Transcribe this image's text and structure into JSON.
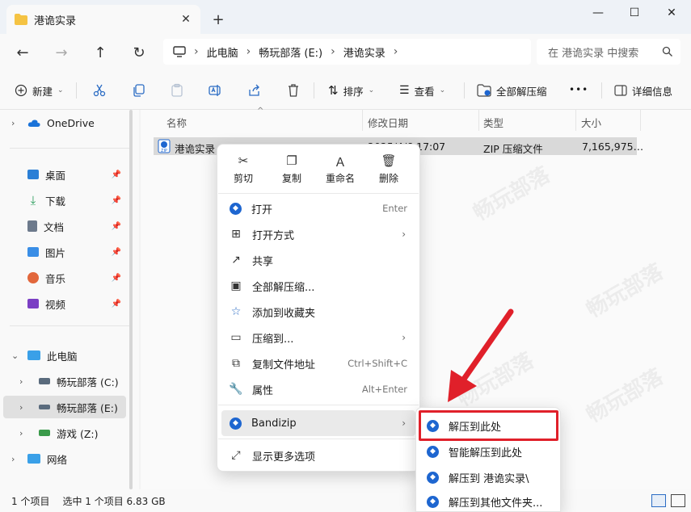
{
  "window": {
    "tab_title": "港诡实录",
    "tab_close_glyph": "✕",
    "new_tab_glyph": "+",
    "min_glyph": "—",
    "max_glyph": "☐",
    "close_glyph": "✕"
  },
  "nav": {
    "back": "←",
    "forward": "→",
    "up": "↑",
    "refresh": "↻"
  },
  "address": {
    "crumbs": [
      "此电脑",
      "畅玩部落 (E:)",
      "港诡实录"
    ],
    "sep": "›",
    "search_placeholder": "在 港诡实录 中搜索"
  },
  "toolbar": {
    "new_label": "新建",
    "sort_label": "排序",
    "view_label": "查看",
    "extract_all_label": "全部解压缩",
    "more_label": "•••",
    "details_label": "详细信息"
  },
  "sidebar": {
    "onedrive": "OneDrive",
    "quick": [
      {
        "label": "桌面",
        "color": "#2b7fd6"
      },
      {
        "label": "下载",
        "color": "#2a9d5c"
      },
      {
        "label": "文档",
        "color": "#6d7a8c"
      },
      {
        "label": "图片",
        "color": "#3a8ee6"
      },
      {
        "label": "音乐",
        "color": "#e2673c"
      },
      {
        "label": "视频",
        "color": "#7b3fc4"
      }
    ],
    "this_pc": "此电脑",
    "drives": [
      "畅玩部落 (C:)",
      "畅玩部落 (E:)",
      "游戏 (Z:)"
    ],
    "network": "网络"
  },
  "columns": {
    "name": "名称",
    "modified": "修改日期",
    "type": "类型",
    "size": "大小"
  },
  "file": {
    "name": "港诡实录",
    "modified": "2025/4/6 17:07",
    "type": "ZIP 压缩文件",
    "size": "7,165,975…"
  },
  "status": {
    "count": "1 个项目",
    "selected": "选中 1 个项目  6.83 GB"
  },
  "context_menu": {
    "quick_actions": [
      "剪切",
      "复制",
      "重命名",
      "删除"
    ],
    "items": [
      {
        "label": "打开",
        "accel": "Enter"
      },
      {
        "label": "打开方式",
        "accel": ""
      },
      {
        "label": "共享",
        "accel": ""
      },
      {
        "label": "全部解压缩...",
        "accel": ""
      },
      {
        "label": "添加到收藏夹",
        "accel": ""
      },
      {
        "label": "压缩到...",
        "accel": ""
      },
      {
        "label": "复制文件地址",
        "accel": "Ctrl+Shift+C"
      },
      {
        "label": "属性",
        "accel": "Alt+Enter"
      },
      {
        "label": "Bandizip",
        "accel": ""
      },
      {
        "label": "显示更多选项",
        "accel": ""
      }
    ]
  },
  "submenu": {
    "items": [
      "解压到此处",
      "智能解压到此处",
      "解压到 港诡实录\\",
      "解压到其他文件夹..."
    ]
  },
  "watermark": "畅玩部落"
}
